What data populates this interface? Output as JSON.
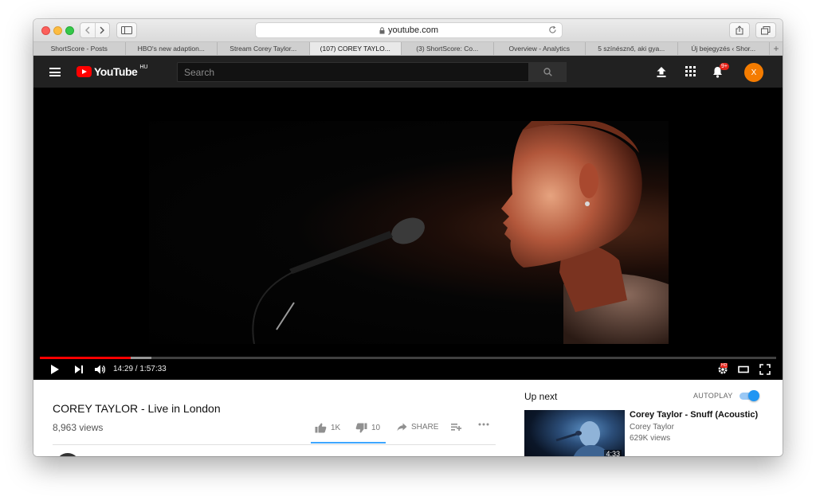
{
  "browser": {
    "url": "youtube.com",
    "tabs": [
      {
        "label": "ShortScore - Posts",
        "active": false
      },
      {
        "label": "HBO's new adaption...",
        "active": false
      },
      {
        "label": "Stream Corey Taylor...",
        "active": false
      },
      {
        "label": "(107) COREY TAYLO...",
        "active": true
      },
      {
        "label": "(3) ShortScore: Co...",
        "active": false
      },
      {
        "label": "Overview - Analytics",
        "active": false
      },
      {
        "label": "5 színésznő, aki gya...",
        "active": false
      },
      {
        "label": "Új bejegyzés ‹ Shor...",
        "active": false
      }
    ],
    "new_tab_glyph": "+"
  },
  "header": {
    "logo_text": "YouTube",
    "region": "HU",
    "search_placeholder": "Search",
    "notification_count": "9+",
    "avatar_letter": "X"
  },
  "player": {
    "current_time": "14:29",
    "duration": "1:57:33",
    "time_display": "14:29 / 1:57:33",
    "progress_fraction": 0.123,
    "buffered_fraction": 0.151,
    "hd_label": "HD"
  },
  "video": {
    "title": "COREY TAYLOR - Live in London",
    "views": "8,963 views",
    "likes": "1K",
    "dislikes": "10",
    "share_label": "SHARE"
  },
  "sidebar": {
    "up_next_label": "Up next",
    "autoplay_label": "AUTOPLAY",
    "autoplay_on": true,
    "recommendation": {
      "title": "Corey Taylor - Snuff (Acoustic)",
      "channel": "Corey Taylor",
      "views": "629K views",
      "duration_partial": "4:33"
    }
  },
  "colors": {
    "brand_red": "#ff0000",
    "header_bg": "#212121",
    "accent_blue": "#3ea6ff",
    "avatar_orange": "#f57c00"
  }
}
